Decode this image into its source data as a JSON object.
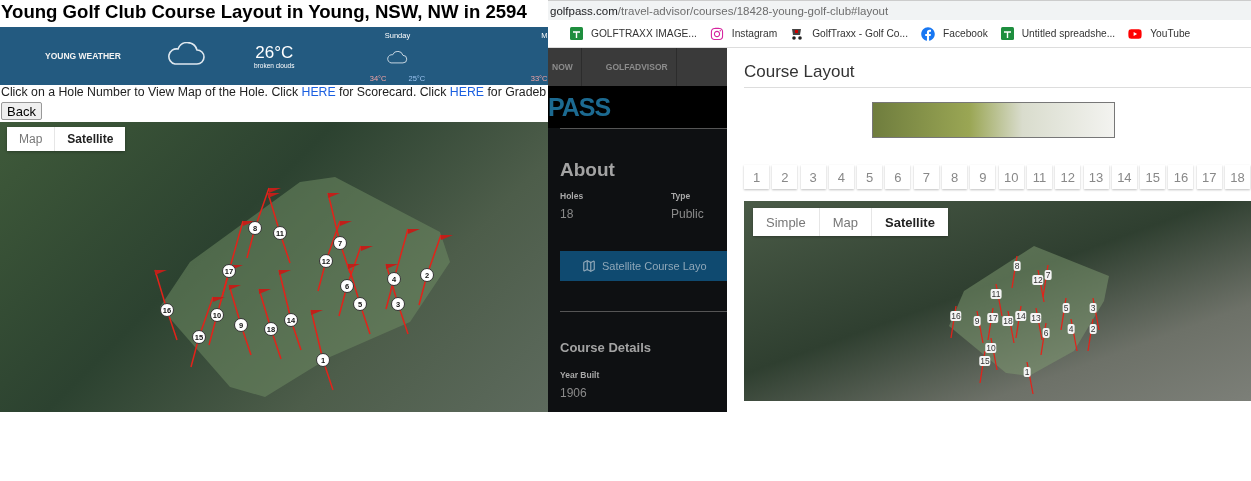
{
  "left_page": {
    "title": "Young Golf Club Course Layout in Young, NSW, NW in 2594",
    "weather": {
      "location": "YOUNG WEATHER",
      "temperature": "26°C",
      "condition": "broken clouds",
      "forecast": [
        {
          "day": "Sunday",
          "high": "34°C",
          "low": "25°C"
        },
        {
          "day": "M",
          "high": "33°C"
        }
      ]
    },
    "instructions": [
      {
        "kind": "text",
        "text": "Click on a Hole Number to View Map of the Hole. Click "
      },
      {
        "kind": "link",
        "text": "HERE"
      },
      {
        "kind": "text",
        "text": " for Scorecard. Click "
      },
      {
        "kind": "link",
        "text": "HERE"
      },
      {
        "kind": "text",
        "text": " for Gradeb"
      }
    ],
    "back_button": "Back",
    "map": {
      "map_types": [
        {
          "label": "Map",
          "selected": false
        },
        {
          "label": "Satellite",
          "selected": true
        }
      ],
      "holes": [
        "1",
        "2",
        "3",
        "4",
        "5",
        "6",
        "7",
        "8",
        "9",
        "10",
        "11",
        "12",
        "14",
        "15",
        "16",
        "17",
        "18"
      ]
    }
  },
  "browser": {
    "url": {
      "domain": "golfpass.com",
      "path": "/travel-advisor/courses/18428-young-golf-club#layout"
    },
    "bookmarks": [
      {
        "kind": "sheet",
        "label": "GOLFTRAXX IMAGE..."
      },
      {
        "kind": "instagram",
        "label": "Instagram"
      },
      {
        "kind": "golf",
        "label": "GolfTraxx - Golf Co..."
      },
      {
        "kind": "facebook",
        "label": "Facebook"
      },
      {
        "kind": "sheet",
        "label": "Untitled spreadshe..."
      },
      {
        "kind": "youtube",
        "label": "YouTube"
      }
    ]
  },
  "course_page": {
    "nav": [
      "NOW",
      "GOLFADVISOR"
    ],
    "logo": "PASS",
    "about_heading": "About",
    "facts": [
      {
        "label": "Holes",
        "value": "18"
      },
      {
        "label": "Type",
        "value": "Public"
      }
    ],
    "layout_button": "Satellite Course Layo",
    "details_heading": "Course Details",
    "year_label": "Year Built",
    "year_value": "1906"
  },
  "layout_panel": {
    "title": "Course Layout",
    "hole_buttons": [
      {
        "label": "1",
        "selected": false
      },
      {
        "label": "2",
        "selected": false
      },
      {
        "label": "3",
        "selected": false
      },
      {
        "label": "4",
        "selected": false
      },
      {
        "label": "5",
        "selected": false
      },
      {
        "label": "6",
        "selected": false
      },
      {
        "label": "7",
        "selected": false
      },
      {
        "label": "8",
        "selected": false
      },
      {
        "label": "9",
        "selected": false
      },
      {
        "label": "10",
        "selected": false
      },
      {
        "label": "11",
        "selected": false
      },
      {
        "label": "12",
        "selected": false
      },
      {
        "label": "13",
        "selected": false
      },
      {
        "label": "14",
        "selected": false
      },
      {
        "label": "15",
        "selected": false
      },
      {
        "label": "16",
        "selected": false
      },
      {
        "label": "17",
        "selected": false
      },
      {
        "label": "18",
        "selected": false
      }
    ],
    "map_types": [
      {
        "label": "Simple",
        "selected": false
      },
      {
        "label": "Map",
        "selected": false
      },
      {
        "label": "Satellite",
        "selected": true
      }
    ],
    "holes": [
      "8",
      "12",
      "7",
      "11",
      "16",
      "9",
      "17",
      "18",
      "14",
      "13",
      "5",
      "3",
      "6",
      "4",
      "2",
      "10",
      "15",
      "1"
    ]
  }
}
